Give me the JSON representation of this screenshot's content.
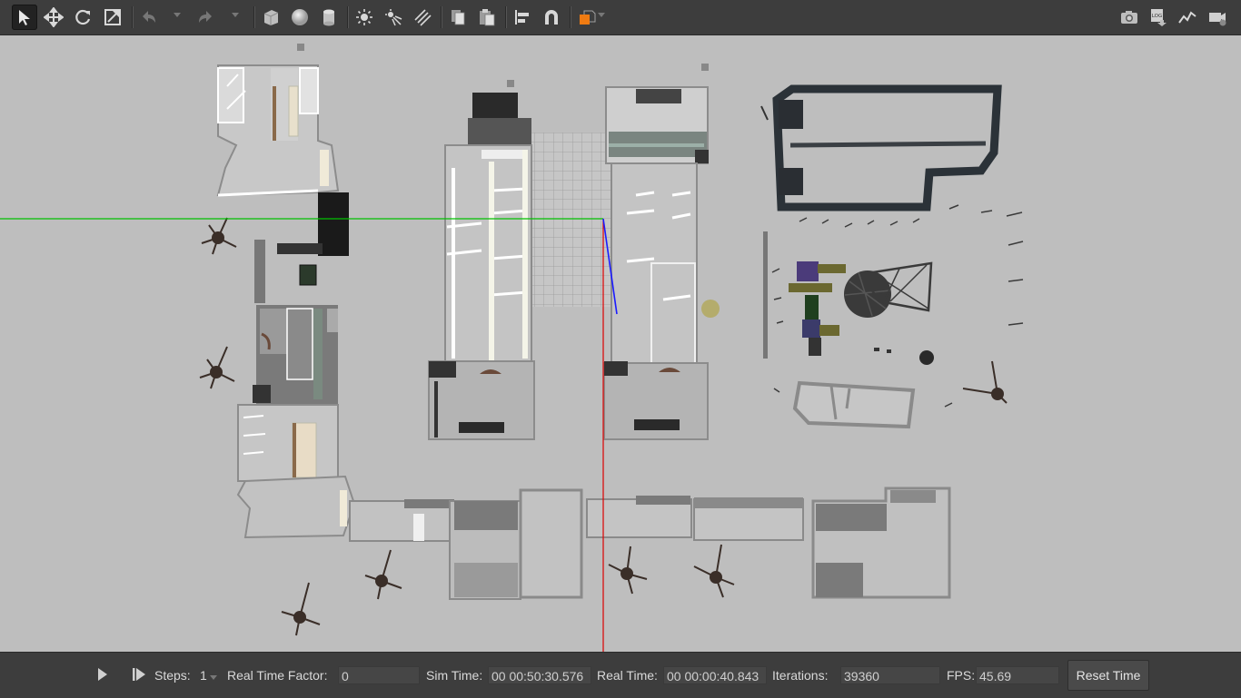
{
  "toolbar": {
    "tools": [
      "select-mode",
      "translate-mode",
      "rotate-mode",
      "scale-mode",
      "undo",
      "redo",
      "box-shape",
      "sphere-shape",
      "cylinder-shape",
      "point-light",
      "spot-light",
      "directional-light",
      "copy",
      "paste",
      "align",
      "magnet-snap",
      "change-view"
    ],
    "right_tools": [
      "screenshot",
      "log",
      "plot",
      "video-record"
    ],
    "log_label": "LOG"
  },
  "viewport": {
    "background": "#bebebe",
    "axis_x_color": "#00cc00",
    "axis_y_color": "#dd0000",
    "axis_z_color": "#0000ee"
  },
  "bottom": {
    "steps_label": "Steps:",
    "steps_value": "1",
    "rtf_label": "Real Time Factor:",
    "rtf_value": "0",
    "sim_time_label": "Sim Time:",
    "sim_time_value": "00 00:50:30.576",
    "real_time_label": "Real Time:",
    "real_time_value": "00 00:00:40.843",
    "iterations_label": "Iterations:",
    "iterations_value": "39360",
    "fps_label": "FPS:",
    "fps_value": "45.69",
    "reset_label": "Reset Time"
  }
}
